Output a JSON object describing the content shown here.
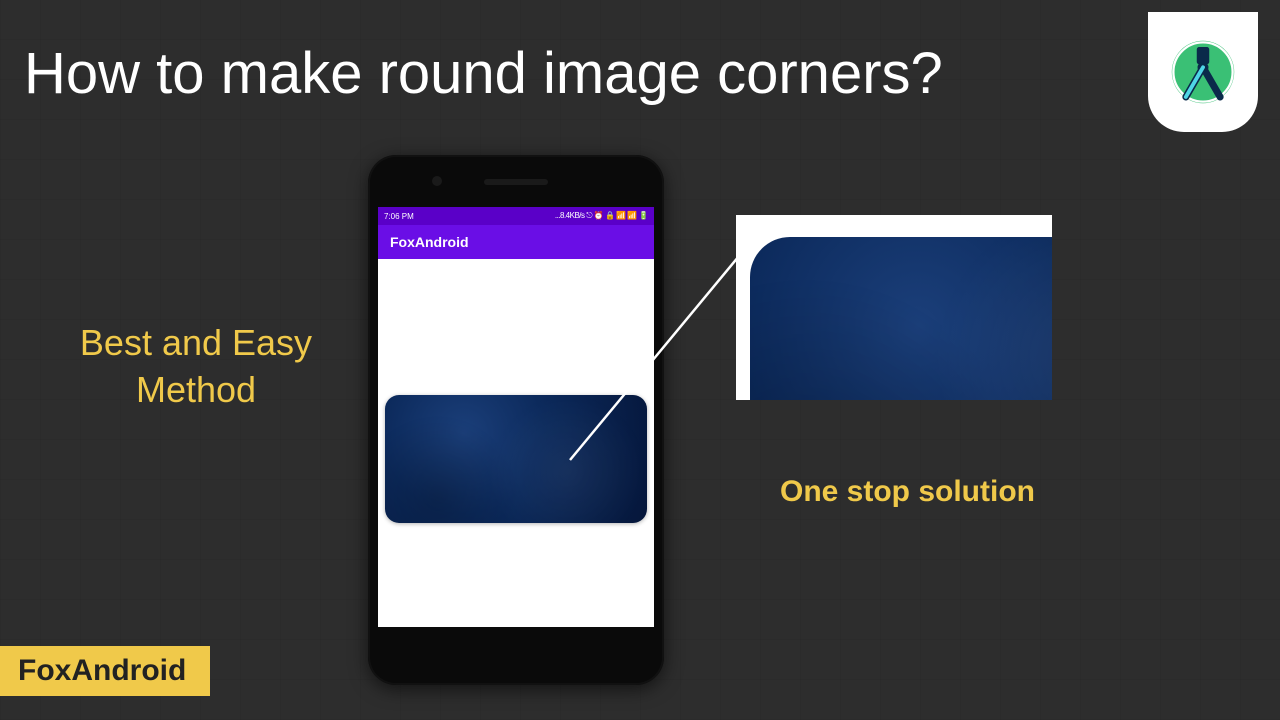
{
  "title": "How to make round image corners?",
  "left_text": "Best and Easy Method",
  "right_text": "One stop solution",
  "brand": "FoxAndroid",
  "phone": {
    "status": {
      "time": "7:06 PM",
      "right": "...8.4KB/s ⎋ ⏰ 🔒 📶 📶 🔋"
    },
    "app_bar_title": "FoxAndroid"
  },
  "colors": {
    "accent_yellow": "#f0c94a",
    "app_bar": "#6a0ee6",
    "status_bar": "#5a00c8",
    "texture_blue": "#0c2a5c"
  }
}
